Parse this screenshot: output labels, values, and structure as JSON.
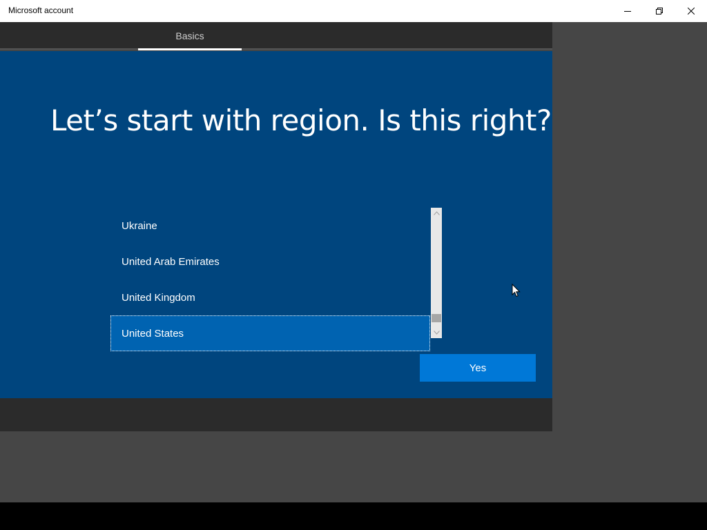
{
  "window": {
    "title": "Microsoft account",
    "controls": {
      "minimize_icon": "minimize-icon",
      "restore_icon": "restore-icon",
      "close_icon": "close-icon"
    }
  },
  "tabs": [
    {
      "label": "Basics",
      "active": true
    }
  ],
  "main": {
    "heading": "Let’s start with region. Is this right?",
    "region_list": {
      "items": [
        {
          "label": "Ukraine",
          "selected": false
        },
        {
          "label": "United Arab Emirates",
          "selected": false
        },
        {
          "label": "United Kingdom",
          "selected": false
        },
        {
          "label": "United States",
          "selected": true
        }
      ]
    },
    "confirm_label": "Yes"
  },
  "colors": {
    "panel_blue": "#00457e",
    "selected_blue": "#0063b1",
    "button_blue": "#0078d7",
    "tabbar": "#2b2b2b",
    "desktop": "#464646"
  }
}
